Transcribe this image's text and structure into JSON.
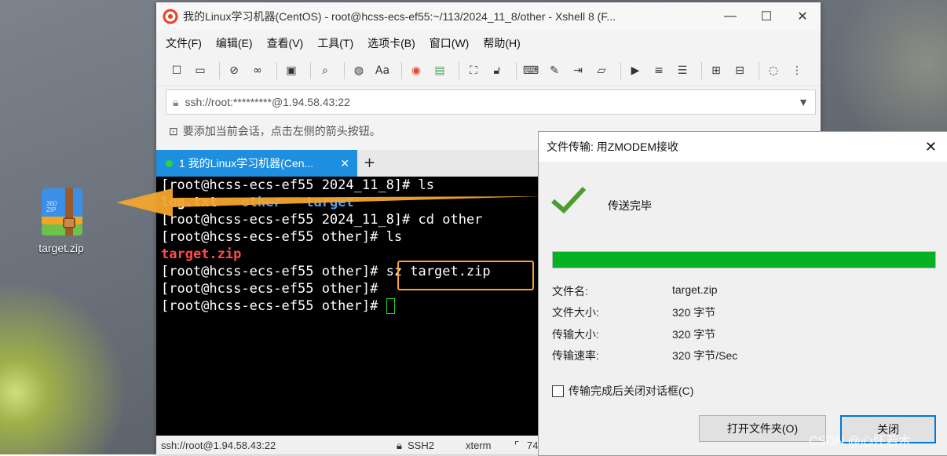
{
  "desktop": {
    "icon_label": "target.zip",
    "zip_brand": "360",
    "zip_text": "ZIP"
  },
  "xshell": {
    "title": "我的Linux学习机器(CentOS) - root@hcss-ecs-ef55:~/113/2024_11_8/other - Xshell 8 (F...",
    "window_controls": {
      "minimize": "—",
      "maximize": "☐",
      "close": "✕"
    },
    "menu": [
      "文件(F)",
      "编辑(E)",
      "查看(V)",
      "工具(T)",
      "选项卡(B)",
      "窗口(W)",
      "帮助(H)"
    ],
    "address": "ssh://root:*********@1.94.58.43:22",
    "hint": "要添加当前会话，点击左侧的箭头按钮。",
    "tab_label": "1 我的Linux学习机器(Cen...",
    "tab_close": "✕",
    "tab_add": "+",
    "terminal": {
      "lines": [
        {
          "prompt": "[root@hcss-ecs-ef55 2024_11_8]# ",
          "cmd": "ls"
        },
        {
          "files": [
            {
              "name": "log.txt",
              "color": "#ffffff"
            },
            {
              "name": "other",
              "color": "#4aa3ff"
            },
            {
              "name": "target",
              "color": "#4aa3ff"
            }
          ]
        },
        {
          "prompt": "[root@hcss-ecs-ef55 2024_11_8]# ",
          "cmd": "cd other"
        },
        {
          "prompt": "[root@hcss-ecs-ef55 other]# ",
          "cmd": "ls"
        },
        {
          "files": [
            {
              "name": "target.zip",
              "color": "#ff4b4b"
            }
          ]
        },
        {
          "prompt": "[root@hcss-ecs-ef55 other]# ",
          "cmd": "sz target.zip"
        },
        {
          "prompt": "[root@hcss-ecs-ef55 other]# ",
          "cmd": ""
        },
        {
          "prompt": "[root@hcss-ecs-ef55 other]# ",
          "cmd": "",
          "cursor": true
        }
      ]
    },
    "status": {
      "session": "ssh://root@1.94.58.43:22",
      "protocol": "SSH2",
      "term": "xterm",
      "size": "74"
    }
  },
  "dialog": {
    "title": "文件传输: 用ZMODEM接收",
    "close": "✕",
    "status_text": "传送完毕",
    "progress": 1.0,
    "fields": [
      {
        "label": "文件名:",
        "value": "target.zip"
      },
      {
        "label": "文件大小:",
        "value": "320 字节"
      },
      {
        "label": "传输大小:",
        "value": "320 字节"
      },
      {
        "label": "传输速率:",
        "value": "320 字节/Sec"
      }
    ],
    "close_after_checkbox": "传输完成后关闭对话框(C)",
    "open_folder_button": "打开文件夹(O)",
    "close_button": "关闭"
  },
  "watermark": "CSDN @心怀若木",
  "colors": {
    "accent_tab": "#1e8fe0",
    "highlight": "#f3a52e",
    "progress": "#06b025"
  }
}
